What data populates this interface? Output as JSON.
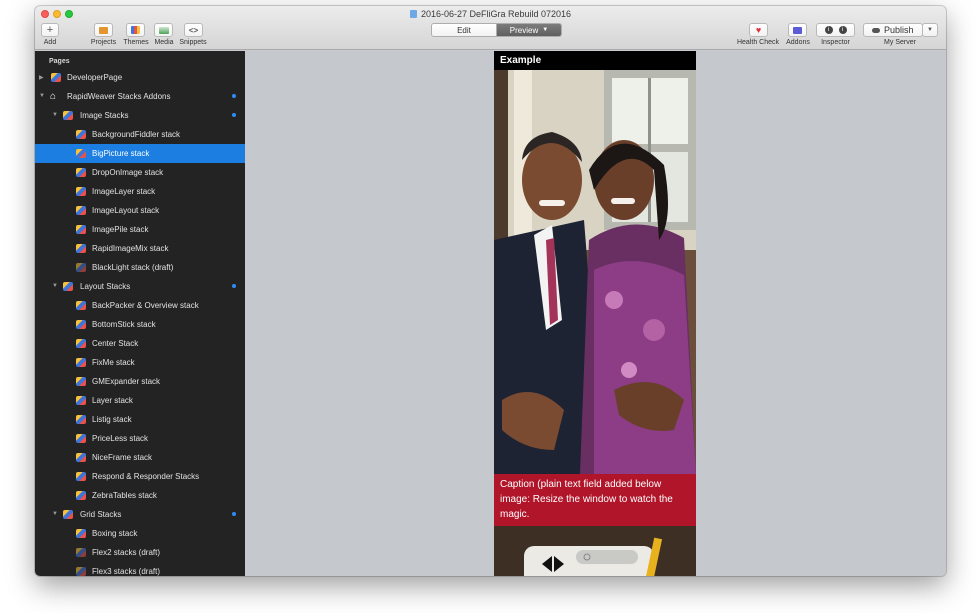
{
  "window": {
    "title": "2016-06-27 DeFliGra Rebuild 072016"
  },
  "toolbar": {
    "add_label": "Add",
    "projects_label": "Projects",
    "themes_label": "Themes",
    "media_label": "Media",
    "snippets_label": "Snippets",
    "edit_label": "Edit",
    "preview_label": "Preview",
    "health_check_label": "Health Check",
    "addons_label": "Addons",
    "inspector_label": "Inspector",
    "publish_label": "Publish",
    "server_label": "My Server"
  },
  "sidebar": {
    "header": "Pages",
    "items": [
      {
        "label": "DeveloperPage"
      },
      {
        "label": "RapidWeaver Stacks Addons"
      },
      {
        "label": "Image Stacks"
      },
      {
        "label": "BackgroundFiddler stack"
      },
      {
        "label": "BigPicture stack"
      },
      {
        "label": "DropOnImage stack"
      },
      {
        "label": "ImageLayer stack"
      },
      {
        "label": "ImageLayout stack"
      },
      {
        "label": "ImagePile stack"
      },
      {
        "label": "RapidImageMix stack"
      },
      {
        "label": "BlackLight stack (draft)"
      },
      {
        "label": "Layout Stacks"
      },
      {
        "label": "BackPacker & Overview stack"
      },
      {
        "label": "BottomStick stack"
      },
      {
        "label": "Center Stack"
      },
      {
        "label": "FixMe stack"
      },
      {
        "label": "GMExpander stack"
      },
      {
        "label": "Layer stack"
      },
      {
        "label": "Listig stack"
      },
      {
        "label": "PriceLess stack"
      },
      {
        "label": "NiceFrame stack"
      },
      {
        "label": "Respond & Responder Stacks"
      },
      {
        "label": "ZebraTables stack"
      },
      {
        "label": "Grid Stacks"
      },
      {
        "label": "Boxing stack"
      },
      {
        "label": "Flex2 stacks (draft)"
      },
      {
        "label": "Flex3 stacks (draft)"
      }
    ]
  },
  "preview": {
    "heading": "Example",
    "caption": "Caption (plain text field added below image: Resize the window to watch the magic."
  },
  "colors": {
    "selection": "#1b7ee0",
    "sidebar_bg": "#232323",
    "caption_bg": "#b0152a",
    "canvas_bg": "#c5c8cd",
    "badge_dot": "#2b8df5"
  }
}
